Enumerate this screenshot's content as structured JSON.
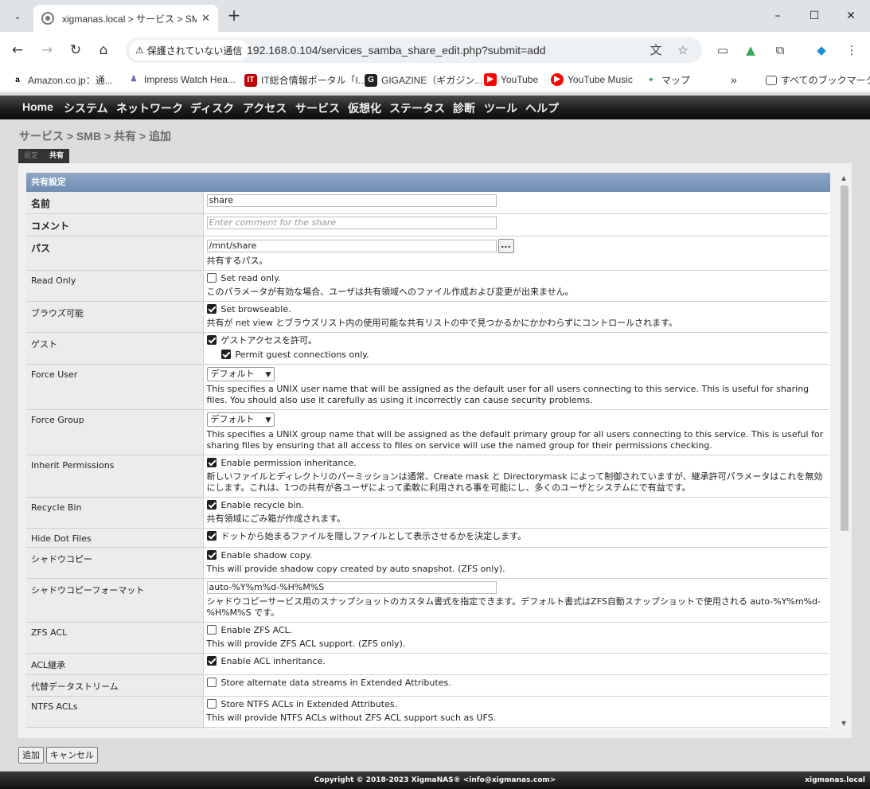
{
  "browser": {
    "tab_title": "xigmanas.local > サービス > SMB",
    "window_controls": {
      "minimize": "–",
      "maximize": "☐",
      "close": "✕"
    },
    "security_label": "保護されていない通信",
    "url": "192.168.0.104/services_samba_share_edit.php?submit=add",
    "bookmarks": [
      {
        "label": "Amazon.co.jp：通...",
        "icon": "amazon-icon",
        "color": "#ff9900"
      },
      {
        "label": "Impress Watch Hea...",
        "icon": "impress-icon",
        "color": "#6b6bb4"
      },
      {
        "label": "IT総合情報ポータル「I...",
        "icon": "itmedia-icon",
        "color": "#c00000"
      },
      {
        "label": "GIGAZINE（ギガジン...",
        "icon": "gigazine-icon",
        "color": "#222222"
      },
      {
        "label": "YouTube",
        "icon": "youtube-icon",
        "color": "#ff0000"
      },
      {
        "label": "YouTube Music",
        "icon": "youtube-music-icon",
        "color": "#ff0000"
      },
      {
        "label": "マップ",
        "icon": "maps-icon",
        "color": "#34a853"
      }
    ],
    "bookmarks_overflow": "»",
    "all_bookmarks": "すべてのブックマーク"
  },
  "menu": [
    "Home",
    "システム",
    "ネットワーク",
    "ディスク",
    "アクセス",
    "サービス",
    "仮想化",
    "ステータス",
    "診断",
    "ツール",
    "ヘルプ"
  ],
  "breadcrumb": "サービス > SMB > 共有 > 追加",
  "subtabs": {
    "settings": "設定",
    "shares": "共有"
  },
  "section_title": "共有設定",
  "fields": {
    "name": {
      "label": "名前",
      "value": "share"
    },
    "comment": {
      "label": "コメント",
      "placeholder": "Enter comment for the share"
    },
    "path": {
      "label": "パス",
      "value": "/mnt/share",
      "browse": "...",
      "desc": "共有するパス。"
    },
    "read_only": {
      "label": "Read Only",
      "checkbox": "Set read only.",
      "checked": false,
      "desc": "このパラメータが有効な場合、ユーザは共有領域へのファイル作成および変更が出来ません。"
    },
    "browseable": {
      "label": "ブラウズ可能",
      "checkbox": "Set browseable.",
      "checked": true,
      "desc": "共有が net view とブラウズリスト内の使用可能な共有リストの中で見つかるかにかかわらずにコントロールされます。"
    },
    "guest": {
      "label": "ゲスト",
      "checkbox": "ゲストアクセスを許可。",
      "checked": true,
      "sub_checkbox": "Permit guest connections only.",
      "sub_checked": true
    },
    "force_user": {
      "label": "Force User",
      "selected": "デフォルト",
      "desc": "This specifies a UNIX user name that will be assigned as the default user for all users connecting to this service. This is useful for sharing files. You should also use it carefully as using it incorrectly can cause security problems."
    },
    "force_group": {
      "label": "Force Group",
      "selected": "デフォルト",
      "desc": "This specifies a UNIX group name that will be assigned as the default primary group for all users connecting to this service. This is useful for sharing files by ensuring that all access to files on service will use the named group for their permissions checking."
    },
    "inherit_permissions": {
      "label": "Inherit Permissions",
      "checkbox": "Enable permission inheritance.",
      "checked": true,
      "desc": "新しいファイルとディレクトリのパーミッションは通常、Create mask と Directorymask によって制御されていますが、継承許可パラメータはこれを無効にします。これは、1つの共有が各ユーザによって柔軟に利用される事を可能にし、多くのユーザとシステムにで有益です。"
    },
    "recycle_bin": {
      "label": "Recycle Bin",
      "checkbox": "Enable recycle bin.",
      "checked": true,
      "desc": "共有領域にごみ箱が作成されます。"
    },
    "hide_dot_files": {
      "label": "Hide Dot Files",
      "checkbox": "ドットから始まるファイルを隠しファイルとして表示させるかを決定します。",
      "checked": true
    },
    "shadow_copy": {
      "label": "シャドウコピー",
      "checkbox": "Enable shadow copy.",
      "checked": true,
      "desc": "This will provide shadow copy created by auto snapshot. (ZFS only)."
    },
    "shadow_copy_format": {
      "label": "シャドウコピーフォーマット",
      "value": "auto-%Y%m%d-%H%M%S",
      "desc": "シャドウコピーサービス用のスナップショットのカスタム書式を指定できます。デフォルト書式はZFS自動スナップショットで使用される auto-%Y%m%d-%H%M%S です。"
    },
    "zfs_acl": {
      "label": "ZFS ACL",
      "checkbox": "Enable ZFS ACL.",
      "checked": false,
      "desc": "This will provide ZFS ACL support. (ZFS only)."
    },
    "acl_inherit": {
      "label": "ACL継承",
      "checkbox": "Enable ACL inheritance.",
      "checked": true
    },
    "alt_streams": {
      "label": "代替データストリーム",
      "checkbox": "Store alternate data streams in Extended Attributes.",
      "checked": false
    },
    "ntfs_acls": {
      "label": "NTFS ACLs",
      "checkbox": "Store NTFS ACLs in Extended Attributes.",
      "checked": false,
      "desc": "This will provide NTFS ACLs without ZFS ACL support such as UFS."
    }
  },
  "buttons": {
    "add": "追加",
    "cancel": "キャンセル"
  },
  "footer": {
    "copyright": "Copyright © 2018-2023 XigmaNAS® <info@xigmanas.com>",
    "host": "xigmanas.local"
  }
}
